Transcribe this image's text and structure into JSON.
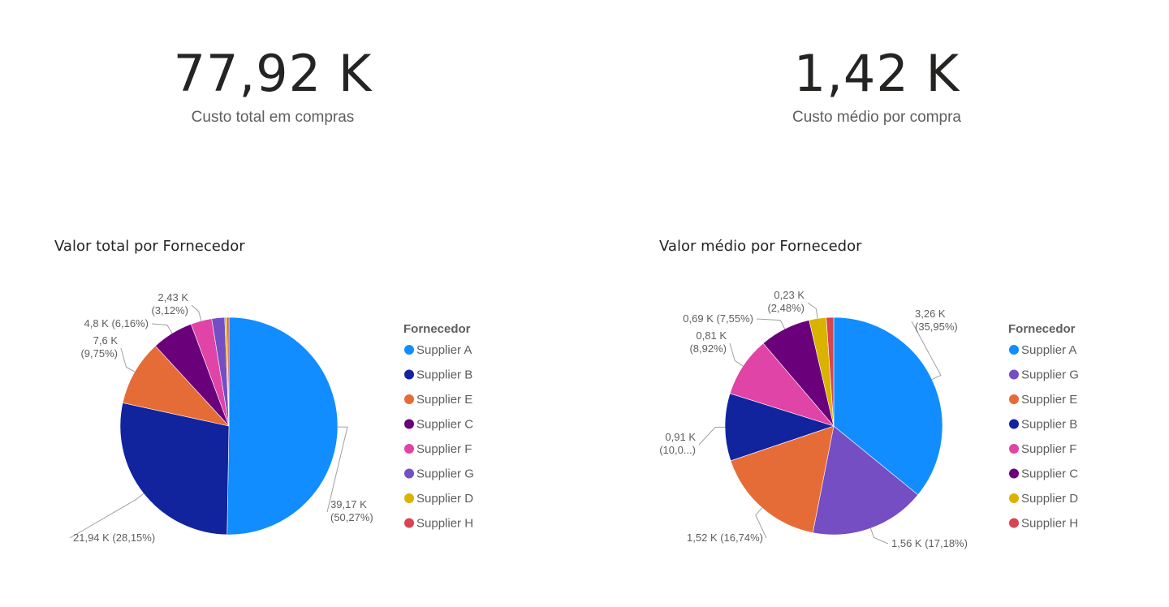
{
  "kpis": [
    {
      "value": "77,92 K",
      "label": "Custo total em compras"
    },
    {
      "value": "1,42 K",
      "label": "Custo médio por compra"
    }
  ],
  "chart_data": [
    {
      "type": "pie",
      "title": "Valor total por Fornecedor",
      "legend_title": "Fornecedor",
      "legend_position": "right",
      "slices": [
        {
          "name": "Supplier A",
          "value": 39.17,
          "percent": 50.27,
          "label": "39,17 K\n(50,27%)",
          "color": "#118DFF"
        },
        {
          "name": "Supplier B",
          "value": 21.94,
          "percent": 28.15,
          "label": "21,94 K (28,15%)",
          "color": "#12239E"
        },
        {
          "name": "Supplier E",
          "value": 7.6,
          "percent": 9.75,
          "label": "7,6 K\n(9,75%)",
          "color": "#E66C37"
        },
        {
          "name": "Supplier C",
          "value": 4.8,
          "percent": 6.16,
          "label": "4,8 K (6,16%)",
          "color": "#6B007B"
        },
        {
          "name": "Supplier F",
          "value": 2.43,
          "percent": 3.12,
          "label": "2,43 K\n(3,12%)",
          "color": "#E044A7"
        },
        {
          "name": "Supplier G",
          "value": 1.5,
          "percent": 1.93,
          "label": "",
          "color": "#744EC2"
        },
        {
          "name": "Supplier D",
          "value": 0.25,
          "percent": 0.32,
          "label": "",
          "color": "#D9B300"
        },
        {
          "name": "Supplier H",
          "value": 0.23,
          "percent": 0.3,
          "label": "",
          "color": "#D64550"
        }
      ]
    },
    {
      "type": "pie",
      "title": "Valor médio por Fornecedor",
      "legend_title": "Fornecedor",
      "legend_position": "right",
      "slices": [
        {
          "name": "Supplier A",
          "value": 3.26,
          "percent": 35.95,
          "label": "3,26 K\n(35,95%)",
          "color": "#118DFF"
        },
        {
          "name": "Supplier G",
          "value": 1.56,
          "percent": 17.18,
          "label": "1,56 K (17,18%)",
          "color": "#744EC2"
        },
        {
          "name": "Supplier E",
          "value": 1.52,
          "percent": 16.74,
          "label": "1,52 K (16,74%)",
          "color": "#E66C37"
        },
        {
          "name": "Supplier B",
          "value": 0.91,
          "percent": 10.0,
          "label": "0,91 K\n(10,0...)",
          "color": "#12239E"
        },
        {
          "name": "Supplier F",
          "value": 0.81,
          "percent": 8.92,
          "label": "0,81 K\n(8,92%)",
          "color": "#E044A7"
        },
        {
          "name": "Supplier C",
          "value": 0.69,
          "percent": 7.55,
          "label": "0,69 K (7,55%)",
          "color": "#6B007B"
        },
        {
          "name": "Supplier D",
          "value": 0.23,
          "percent": 2.48,
          "label": "0,23 K\n(2,48%)",
          "color": "#D9B300"
        },
        {
          "name": "Supplier H",
          "value": 0.1,
          "percent": 1.18,
          "label": "",
          "color": "#D64550"
        }
      ]
    }
  ]
}
